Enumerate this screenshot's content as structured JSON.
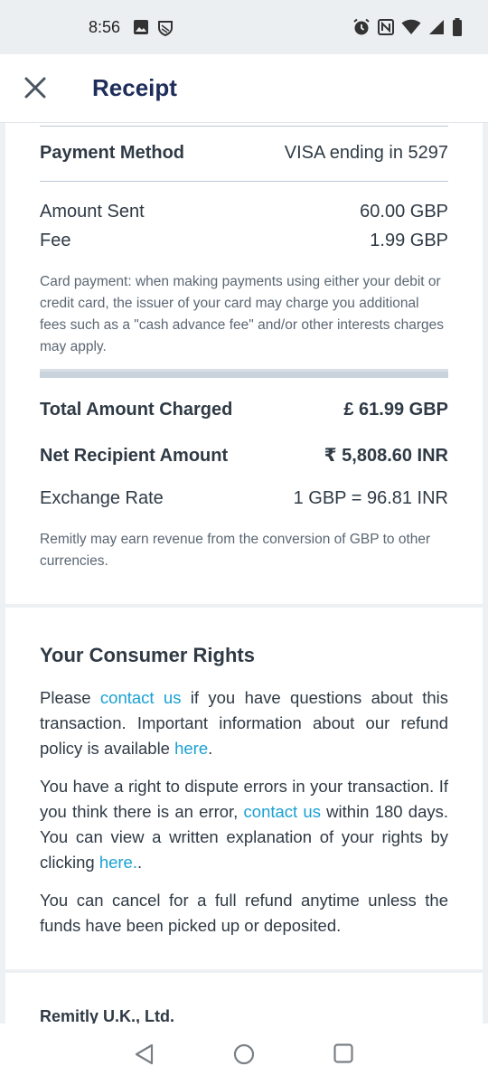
{
  "status_bar": {
    "time": "8:56",
    "left_icons": [
      "image-icon",
      "shield-icon"
    ],
    "right_icons": [
      "alarm-icon",
      "nfc-icon",
      "wifi-icon",
      "signal-icon",
      "battery-icon"
    ]
  },
  "header": {
    "title": "Receipt",
    "close_icon": "close-icon"
  },
  "payment": {
    "method_label": "Payment Method",
    "method_value": "VISA ending in 5297",
    "amount_sent_label": "Amount Sent",
    "amount_sent_value": "60.00 GBP",
    "fee_label": "Fee",
    "fee_value": "1.99 GBP",
    "card_note": "Card payment: when making payments using either your debit or credit card, the issuer of your card may charge you additional fees such as a \"cash advance fee\" and/or other interests charges may apply.",
    "total_label": "Total Amount Charged",
    "total_value": "£ 61.99 GBP",
    "net_label": "Net Recipient Amount",
    "net_value": "₹ 5,808.60 INR",
    "rate_label": "Exchange Rate",
    "rate_value": "1 GBP = 96.81 INR",
    "rate_note": "Remitly may earn revenue from the conversion of GBP to other currencies."
  },
  "rights": {
    "title": "Your Consumer Rights",
    "p1_a": "Please ",
    "p1_link1": "contact us",
    "p1_b": " if you have questions about this transaction. Important information about our refund policy is available ",
    "p1_link2": "here",
    "p1_c": ".",
    "p2_a": "You have a right to dispute errors in your transaction. If you think there is an error, ",
    "p2_link1": "contact us",
    "p2_b": " within 180 days. You can view a written explanation of your rights by clicking ",
    "p2_link2": "here.",
    "p2_c": ".",
    "p3": "You can cancel for a full refund anytime unless the funds have been picked up or deposited."
  },
  "footer": {
    "company": "Remitly U.K., Ltd."
  },
  "nav_bar": {
    "buttons": [
      "back-icon",
      "home-icon",
      "recents-icon"
    ]
  },
  "colors": {
    "title": "#1e2d5a",
    "link": "#1aa0d2",
    "text": "#2f3a45",
    "muted": "#5b6773"
  }
}
